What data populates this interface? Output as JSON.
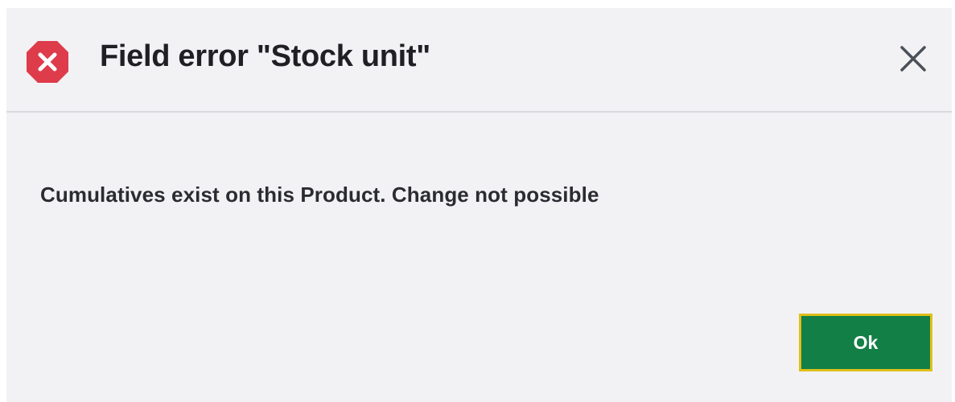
{
  "dialog": {
    "title": "Field error \"Stock unit\"",
    "message": "Cumulatives exist on this Product. Change not possible",
    "ok_label": "Ok",
    "icons": {
      "status": "error-octagon-icon",
      "close": "close-icon"
    }
  },
  "colors": {
    "error_icon": "#de3c4b",
    "ok_button": "#127f46",
    "ok_focus_border": "#e0c01a",
    "dialog_background": "#f2f2f4"
  }
}
